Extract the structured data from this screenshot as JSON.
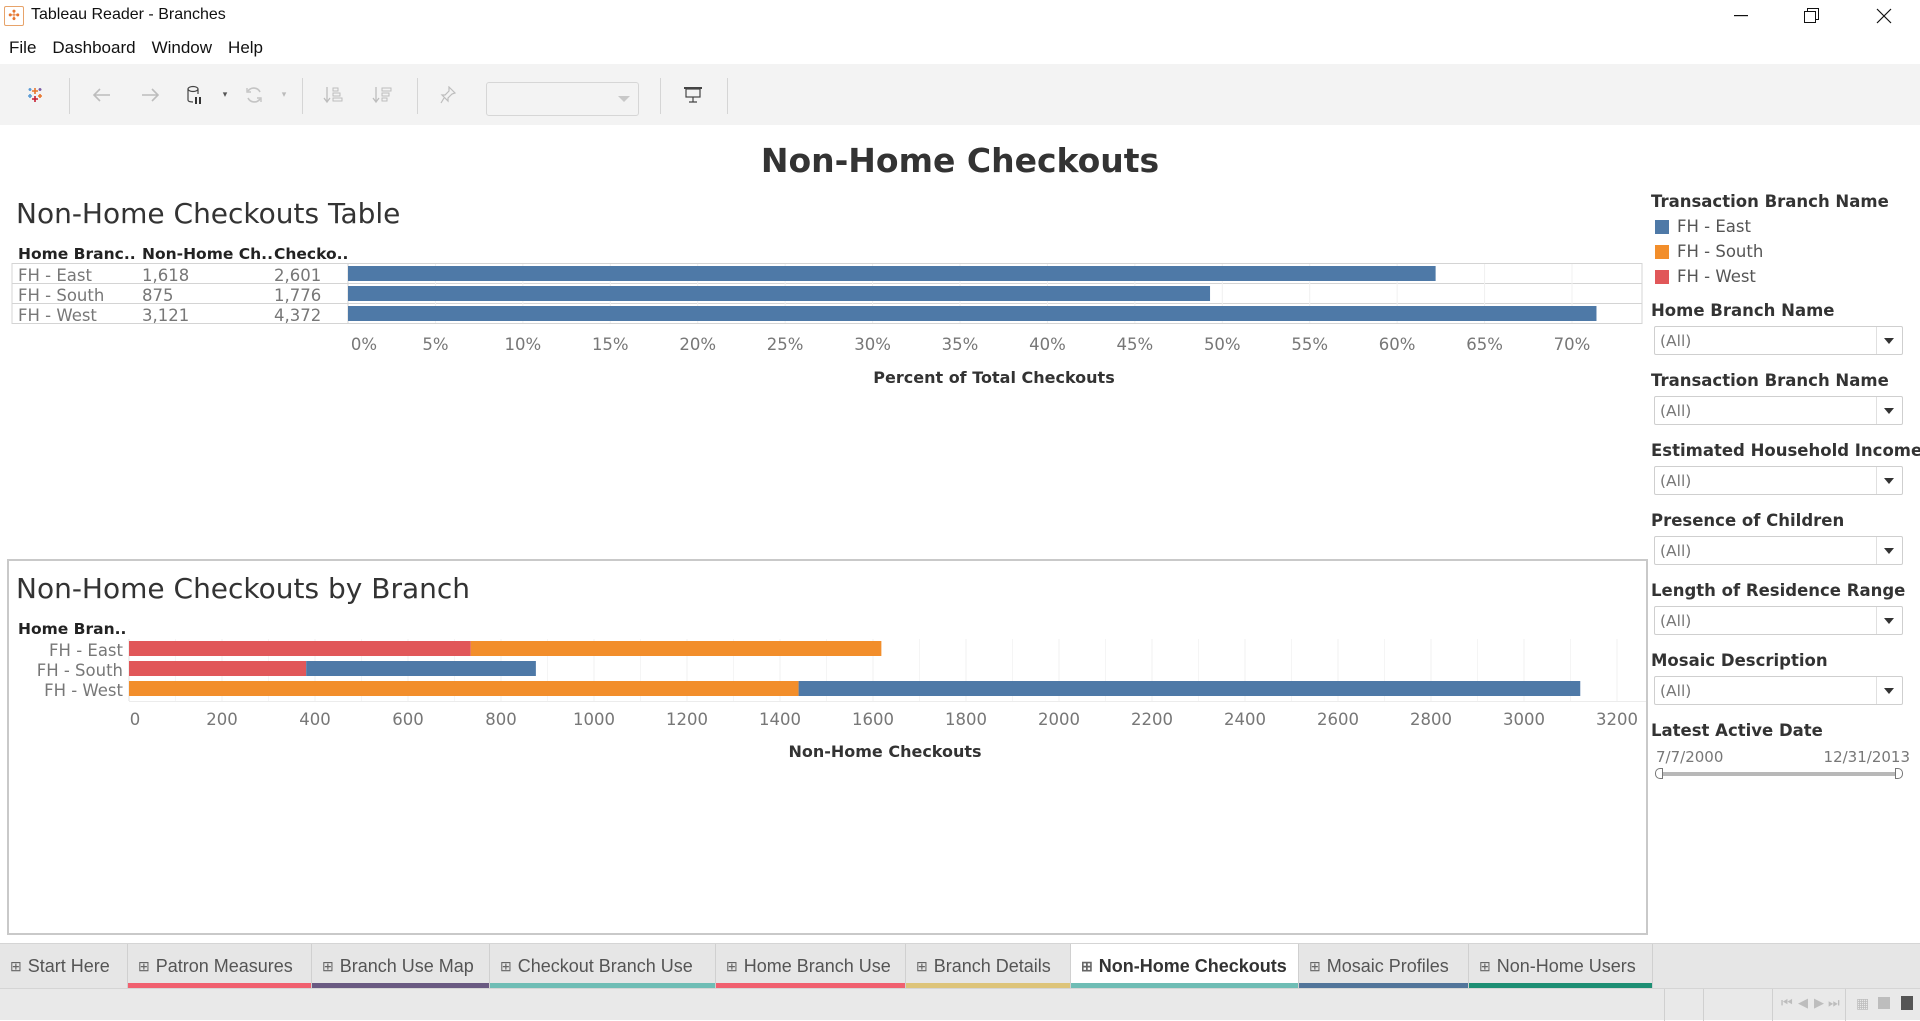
{
  "window": {
    "title": "Tableau Reader - Branches",
    "controls": [
      "minimize",
      "restore",
      "close"
    ]
  },
  "menu": [
    "File",
    "Dashboard",
    "Window",
    "Help"
  ],
  "toolbar": {
    "items": [
      "tableau-logo-icon",
      "back-arrow-icon",
      "forward-arrow-icon",
      "pause-data-updates-icon",
      "refresh-icon",
      "sort-ascending-icon",
      "sort-descending-icon",
      "pin-icon",
      "presentation-mode-icon"
    ],
    "dropdown_value": ""
  },
  "dashboard": {
    "title": "Non-Home Checkouts"
  },
  "table_sheet": {
    "title": "Non-Home Checkouts Table",
    "columns": [
      "Home Branc..",
      "Non-Home Ch..",
      "Checko.."
    ],
    "rows": [
      {
        "branch": "FH - East",
        "non_home": "1,618",
        "checkouts": "2,601"
      },
      {
        "branch": "FH - South",
        "non_home": "875",
        "checkouts": "1,776"
      },
      {
        "branch": "FH - West",
        "non_home": "3,121",
        "checkouts": "4,372"
      }
    ]
  },
  "branch_sheet": {
    "title": "Non-Home Checkouts by Branch",
    "row_header": "Home Bran.."
  },
  "chart_data": [
    {
      "type": "bar",
      "title": "Non-Home Checkouts Table",
      "orientation": "horizontal",
      "categories": [
        "FH - East",
        "FH - South",
        "FH - West"
      ],
      "values": [
        62.2,
        49.3,
        71.4
      ],
      "xlabel": "Percent of Total Checkouts",
      "ylabel": "Home Branch Name",
      "xlim": [
        0,
        75
      ],
      "ticks": [
        0,
        5,
        10,
        15,
        20,
        25,
        30,
        35,
        40,
        45,
        50,
        55,
        60,
        65,
        70
      ],
      "tick_labels": [
        "0%",
        "5%",
        "10%",
        "15%",
        "20%",
        "25%",
        "30%",
        "35%",
        "40%",
        "45%",
        "50%",
        "55%",
        "60%",
        "65%",
        "70%"
      ],
      "color": "#4e79a7",
      "grid": true
    },
    {
      "type": "bar",
      "stacked": true,
      "orientation": "horizontal",
      "title": "Non-Home Checkouts by Branch",
      "categories": [
        "FH - East",
        "FH - South",
        "FH - West"
      ],
      "series": [
        {
          "name": "FH - West",
          "color": "#e15759",
          "values": [
            735,
            381,
            0
          ]
        },
        {
          "name": "FH - South",
          "color": "#f28e2b",
          "values": [
            883,
            0,
            1440
          ]
        },
        {
          "name": "FH - East",
          "color": "#4e79a7",
          "values": [
            0,
            494,
            1681
          ]
        }
      ],
      "xlabel": "Non-Home Checkouts",
      "ylabel": "Home Branch Name",
      "xlim": [
        0,
        3300
      ],
      "ticks": [
        0,
        200,
        400,
        600,
        800,
        1000,
        1200,
        1400,
        1600,
        1800,
        2000,
        2200,
        2400,
        2600,
        2800,
        3000,
        3200
      ],
      "grid": true,
      "legend": "right"
    }
  ],
  "legend": {
    "title": "Transaction Branch Name",
    "items": [
      {
        "label": "FH - East",
        "color": "#4e79a7"
      },
      {
        "label": "FH - South",
        "color": "#f28e2b"
      },
      {
        "label": "FH - West",
        "color": "#e15759"
      }
    ]
  },
  "filters": [
    {
      "title": "Home Branch Name",
      "value": "(All)"
    },
    {
      "title": "Transaction Branch Name",
      "value": "(All)"
    },
    {
      "title": "Estimated Household Income",
      "value": "(All)"
    },
    {
      "title": "Presence of Children",
      "value": "(All)"
    },
    {
      "title": "Length of Residence Range",
      "value": "(All)"
    },
    {
      "title": "Mosaic Description",
      "value": "(All)"
    }
  ],
  "date_filter": {
    "title": "Latest Active Date",
    "start": "7/7/2000",
    "end": "12/31/2013",
    "range_fraction": [
      0,
      1
    ]
  },
  "tabs": [
    {
      "label": "Start Here",
      "color": "",
      "active": false
    },
    {
      "label": "Patron Measures",
      "color": "#f0606f",
      "active": false
    },
    {
      "label": "Branch Use Map",
      "color": "#6a5a82",
      "active": false
    },
    {
      "label": "Checkout Branch Use",
      "color": "#6fbdb5",
      "active": false
    },
    {
      "label": "Home Branch Use",
      "color": "#f0606f",
      "active": false
    },
    {
      "label": "Branch Details",
      "color": "#ddc47a",
      "active": false
    },
    {
      "label": "Non-Home Checkouts",
      "color": "#6fbdb5",
      "active": true
    },
    {
      "label": "Mosaic Profiles",
      "color": "#52759a",
      "active": false
    },
    {
      "label": "Non-Home Users",
      "color": "#1e8f74",
      "active": false
    }
  ],
  "statusbar": {
    "nav": [
      "first-icon",
      "prev-icon",
      "next-icon",
      "last-icon"
    ],
    "views": [
      "sheet-sorter-icon",
      "filmstrip-icon",
      "tabs-icon"
    ]
  }
}
